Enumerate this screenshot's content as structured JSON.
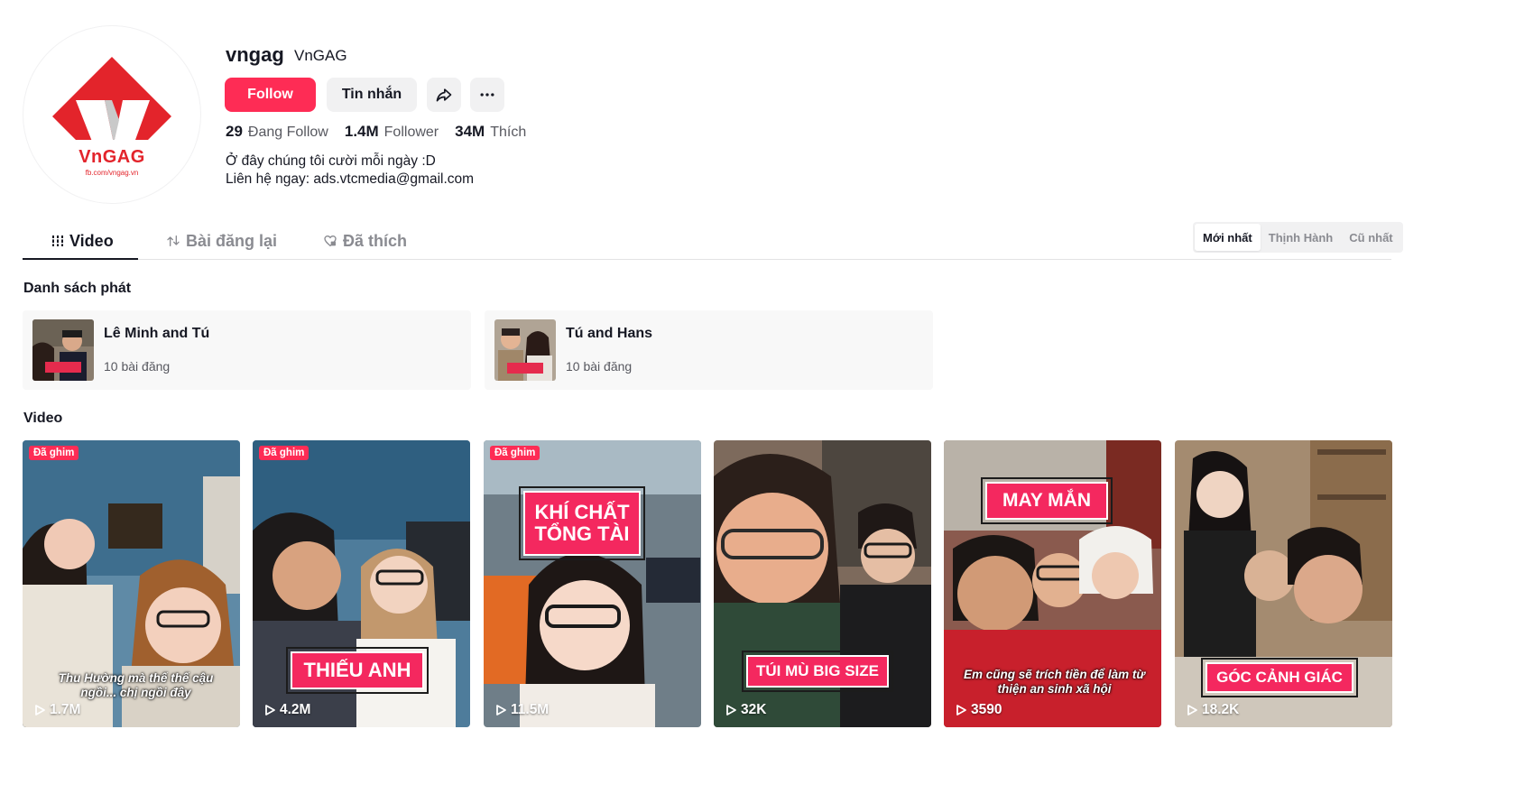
{
  "profile": {
    "username": "vngag",
    "nickname": "VnGAG",
    "avatar_brand": "VnGAG",
    "avatar_sub": "fb.com/vngag.vn",
    "follow_label": "Follow",
    "message_label": "Tin nhắn",
    "share_icon": "share-icon",
    "more_icon": "more-icon",
    "stats": {
      "following_count": "29",
      "following_label": "Đang Follow",
      "followers_count": "1.4M",
      "followers_label": "Follower",
      "likes_count": "34M",
      "likes_label": "Thích"
    },
    "bio_line1": "Ở đây chúng tôi cười mỗi ngày :D",
    "bio_line2": "Liên hệ ngay: ads.vtcmedia@gmail.com"
  },
  "tabs": {
    "video": "Video",
    "repost": "Bài đăng lại",
    "liked": "Đã thích"
  },
  "sort": {
    "newest": "Mới nhất",
    "popular": "Thịnh Hành",
    "oldest": "Cũ nhất"
  },
  "playlists_title": "Danh sách phát",
  "playlists": [
    {
      "name": "Lê Minh and Tú",
      "count": "10 bài đăng"
    },
    {
      "name": "Tú and Hans",
      "count": "10 bài đăng"
    }
  ],
  "videos_title": "Video",
  "videos": [
    {
      "pinned": "Đã ghim",
      "views": "1.7M",
      "caption": "",
      "subtitle": "Thu Hường mà thế thế cậu ngồi... chị ngồi đây"
    },
    {
      "pinned": "Đã ghim",
      "views": "4.2M",
      "caption": "THIẾU ANH",
      "subtitle": ""
    },
    {
      "pinned": "Đã ghim",
      "views": "11.5M",
      "caption": "KHÍ CHẤT TỔNG TÀI",
      "subtitle": ""
    },
    {
      "pinned": "",
      "views": "32K",
      "caption": "TÚI MÙ BIG SIZE",
      "subtitle": ""
    },
    {
      "pinned": "",
      "views": "3590",
      "caption": "MAY MẮN",
      "subtitle": "Em cũng sẽ trích tiền để làm từ thiện an sinh xã hội"
    },
    {
      "pinned": "",
      "views": "18.2K",
      "caption": "GÓC CẢNH GIÁC",
      "subtitle": ""
    }
  ],
  "colors": {
    "accent": "#fe2c55",
    "brand_red": "#e3242b"
  }
}
